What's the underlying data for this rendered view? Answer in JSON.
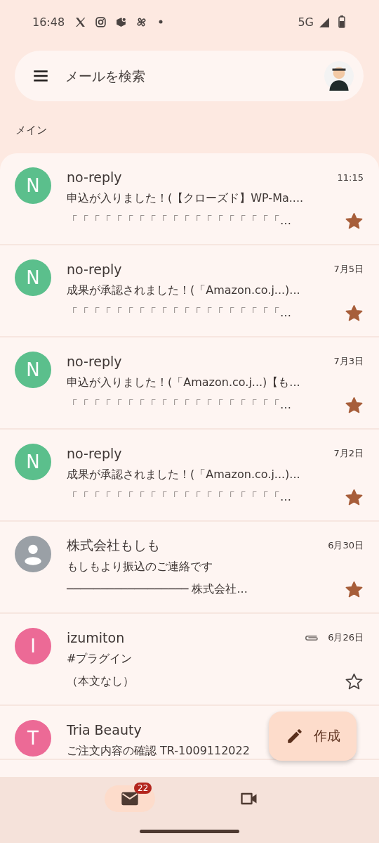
{
  "status_bar": {
    "time": "16:48",
    "network": "5G"
  },
  "search": {
    "placeholder": "メールを検索"
  },
  "section_title": "メイン",
  "emails": [
    {
      "avatar": {
        "kind": "letter",
        "letter": "N",
        "color": "#5bbf8c"
      },
      "sender": "no-reply",
      "date": "11:15",
      "subject": "申込が入りました！(【クローズド】WP-Ma....",
      "snippet": "「「「「「「「「「「「「「「「「「「「…",
      "starred": true,
      "attachment": false
    },
    {
      "avatar": {
        "kind": "letter",
        "letter": "N",
        "color": "#5bbf8c"
      },
      "sender": "no-reply",
      "date": "7月5日",
      "subject": "成果が承認されました！(「Amazon.co.j...)...",
      "snippet": "「「「「「「「「「「「「「「「「「「「…",
      "starred": true,
      "attachment": false
    },
    {
      "avatar": {
        "kind": "letter",
        "letter": "N",
        "color": "#5bbf8c"
      },
      "sender": "no-reply",
      "date": "7月3日",
      "subject": "申込が入りました！(「Amazon.co.j...)【も...",
      "snippet": "「「「「「「「「「「「「「「「「「「「…",
      "starred": true,
      "attachment": false
    },
    {
      "avatar": {
        "kind": "letter",
        "letter": "N",
        "color": "#5bbf8c"
      },
      "sender": "no-reply",
      "date": "7月2日",
      "subject": "成果が承認されました！(「Amazon.co.j...)...",
      "snippet": "「「「「「「「「「「「「「「「「「「「…",
      "starred": true,
      "attachment": false
    },
    {
      "avatar": {
        "kind": "person",
        "color": "#9aa0a6"
      },
      "sender": "株式会社もしも",
      "date": "6月30日",
      "subject": "もしもより振込のご連絡です",
      "snippet": "────────────────── 株式会社...",
      "starred": true,
      "attachment": false
    },
    {
      "avatar": {
        "kind": "letter",
        "letter": "I",
        "color": "#ec6a96"
      },
      "sender": "izumiton",
      "date": "6月26日",
      "subject": "#プラグイン",
      "snippet": "（本文なし）",
      "starred": false,
      "attachment": true
    },
    {
      "avatar": {
        "kind": "letter",
        "letter": "T",
        "color": "#ec6a96"
      },
      "sender": "Tria Beauty",
      "subject": "ご注文内容の確認 TR-1009112022"
    }
  ],
  "compose": {
    "label": "作成"
  },
  "bottom_nav": [
    {
      "kind": "mail",
      "selected": true,
      "badge": "22"
    },
    {
      "kind": "meet",
      "selected": false
    }
  ]
}
